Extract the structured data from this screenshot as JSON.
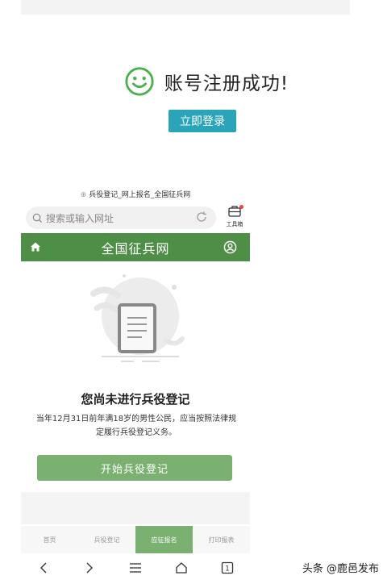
{
  "success": {
    "message": "账号注册成功!",
    "login_button": "立即登录"
  },
  "phone": {
    "page_title": "兵役登记_网上报名_全国征兵网",
    "search_placeholder": "搜索或输入网址",
    "toolbox_label": "工具箱",
    "site_title": "全国征兵网",
    "empty_title": "您尚未进行兵役登记",
    "empty_desc": "当年12月31日前年满18岁的男性公民，应当按照法律规定履行兵役登记义务。",
    "start_button": "开始兵役登记",
    "tabs": [
      {
        "label": "首页",
        "active": false
      },
      {
        "label": "兵役登记",
        "active": false
      },
      {
        "label": "应征报名",
        "active": true
      },
      {
        "label": "打印报表",
        "active": false
      }
    ],
    "header_color": "#4e8e46",
    "accent_color": "#7ab070"
  },
  "watermark": "头条 @鹿邑发布"
}
